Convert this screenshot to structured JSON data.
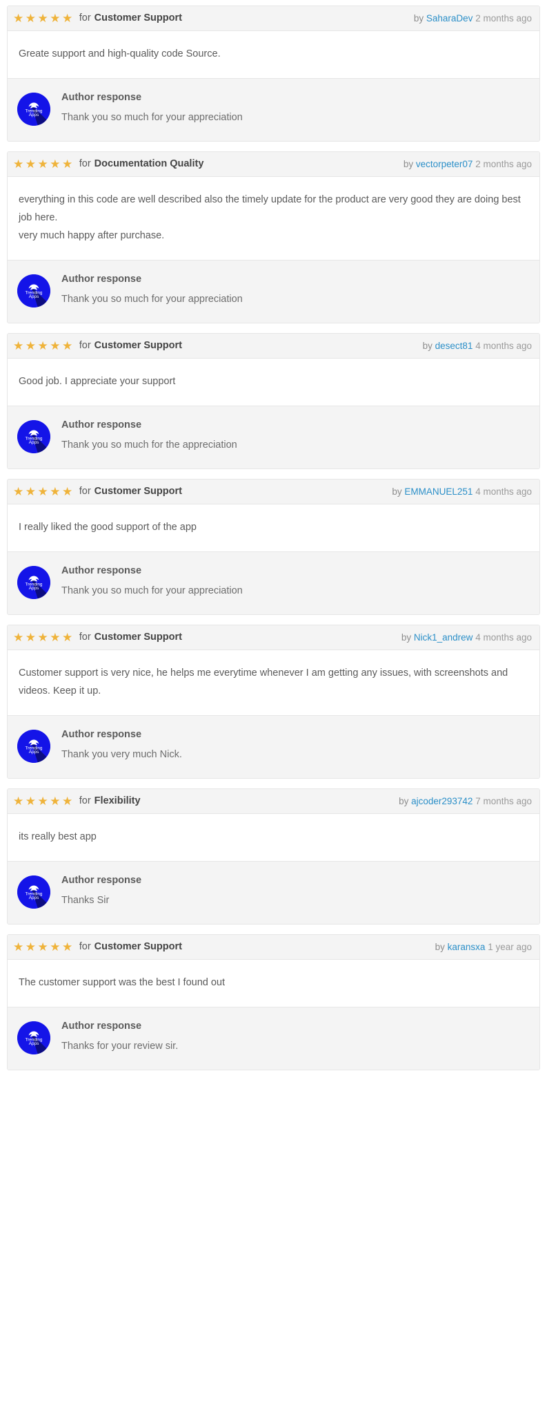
{
  "labels": {
    "for_word": "for",
    "by_word": "by",
    "author_response_title": "Author response",
    "star_glyph": "★",
    "avatar_brand_line1": "Trending",
    "avatar_brand_line2": "Apps"
  },
  "colors": {
    "star": "#efb33a",
    "author_link": "#2b8fc8",
    "header_bg": "#f4f4f4",
    "card_border": "#e6e6e6",
    "avatar_blue": "#1414e8",
    "avatar_shadow": "#0a0a6e",
    "body_text": "#5a5a5a"
  },
  "reviews": [
    {
      "rating": 5,
      "category": "Customer Support",
      "author": "SaharaDev",
      "time_ago": "2 months ago",
      "body": "Greate support and high-quality code Source.",
      "response": "Thank you so much for your appreciation"
    },
    {
      "rating": 5,
      "category": "Documentation Quality",
      "author": "vectorpeter07",
      "time_ago": "2 months ago",
      "body": "everything in this code are well described also the timely update for the product are very good they are doing best job here.\nvery much happy after purchase.",
      "response": "Thank you so much for your appreciation"
    },
    {
      "rating": 5,
      "category": "Customer Support",
      "author": "desect81",
      "time_ago": "4 months ago",
      "body": "Good job. I appreciate your support",
      "response": "Thank you so much for the appreciation"
    },
    {
      "rating": 5,
      "category": "Customer Support",
      "author": "EMMANUEL251",
      "time_ago": "4 months ago",
      "body": "I really liked the good support of the app",
      "response": "Thank you so much for your appreciation"
    },
    {
      "rating": 5,
      "category": "Customer Support",
      "author": "Nick1_andrew",
      "time_ago": "4 months ago",
      "body": "Customer support is very nice, he helps me everytime whenever I am getting any issues, with screenshots and videos. Keep it up.",
      "response": "Thank you very much Nick."
    },
    {
      "rating": 5,
      "category": "Flexibility",
      "author": "ajcoder293742",
      "time_ago": "7 months ago",
      "body": "its really best app",
      "response": "Thanks Sir"
    },
    {
      "rating": 5,
      "category": "Customer Support",
      "author": "karansxa",
      "time_ago": "1 year ago",
      "body": "The customer support was the best I found out",
      "response": "Thanks for your review sir."
    }
  ]
}
